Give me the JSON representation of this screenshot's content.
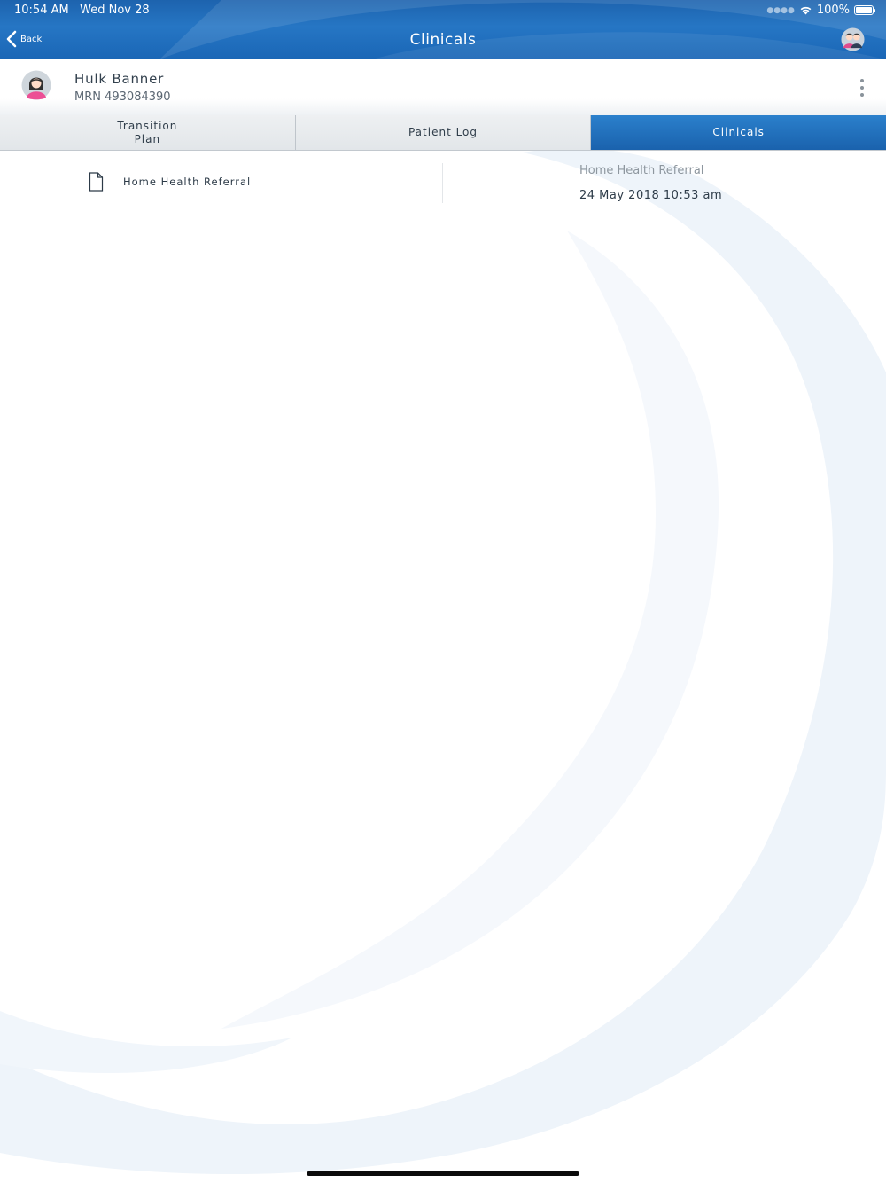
{
  "status_bar": {
    "time": "10:54 AM",
    "date": "Wed Nov 28",
    "battery": "100%"
  },
  "nav": {
    "back_label": "Back",
    "title": "Clinicals"
  },
  "patient": {
    "name": "Hulk Banner",
    "mrn": "MRN 493084390"
  },
  "tabs": [
    {
      "label": "Transition\nPlan",
      "active": false
    },
    {
      "label": "Patient Log",
      "active": false
    },
    {
      "label": "Clinicals",
      "active": true
    }
  ],
  "documents": [
    {
      "label": "Home Health Referral"
    }
  ],
  "detail": {
    "title": "Home Health Referral",
    "date": "24 May 2018 10:53 am"
  },
  "colors": {
    "nav_blue": "#1f6cb9",
    "active_tab": "#1a62ad",
    "text_dark": "#2f3d4a"
  },
  "icons": {
    "back": "chevron-left-icon",
    "nav_avatar": "users-icon",
    "patient_avatar": "female-avatar-icon",
    "menu": "vertical-ellipsis-icon",
    "document": "document-icon",
    "wifi": "wifi-icon",
    "battery": "battery-icon"
  }
}
